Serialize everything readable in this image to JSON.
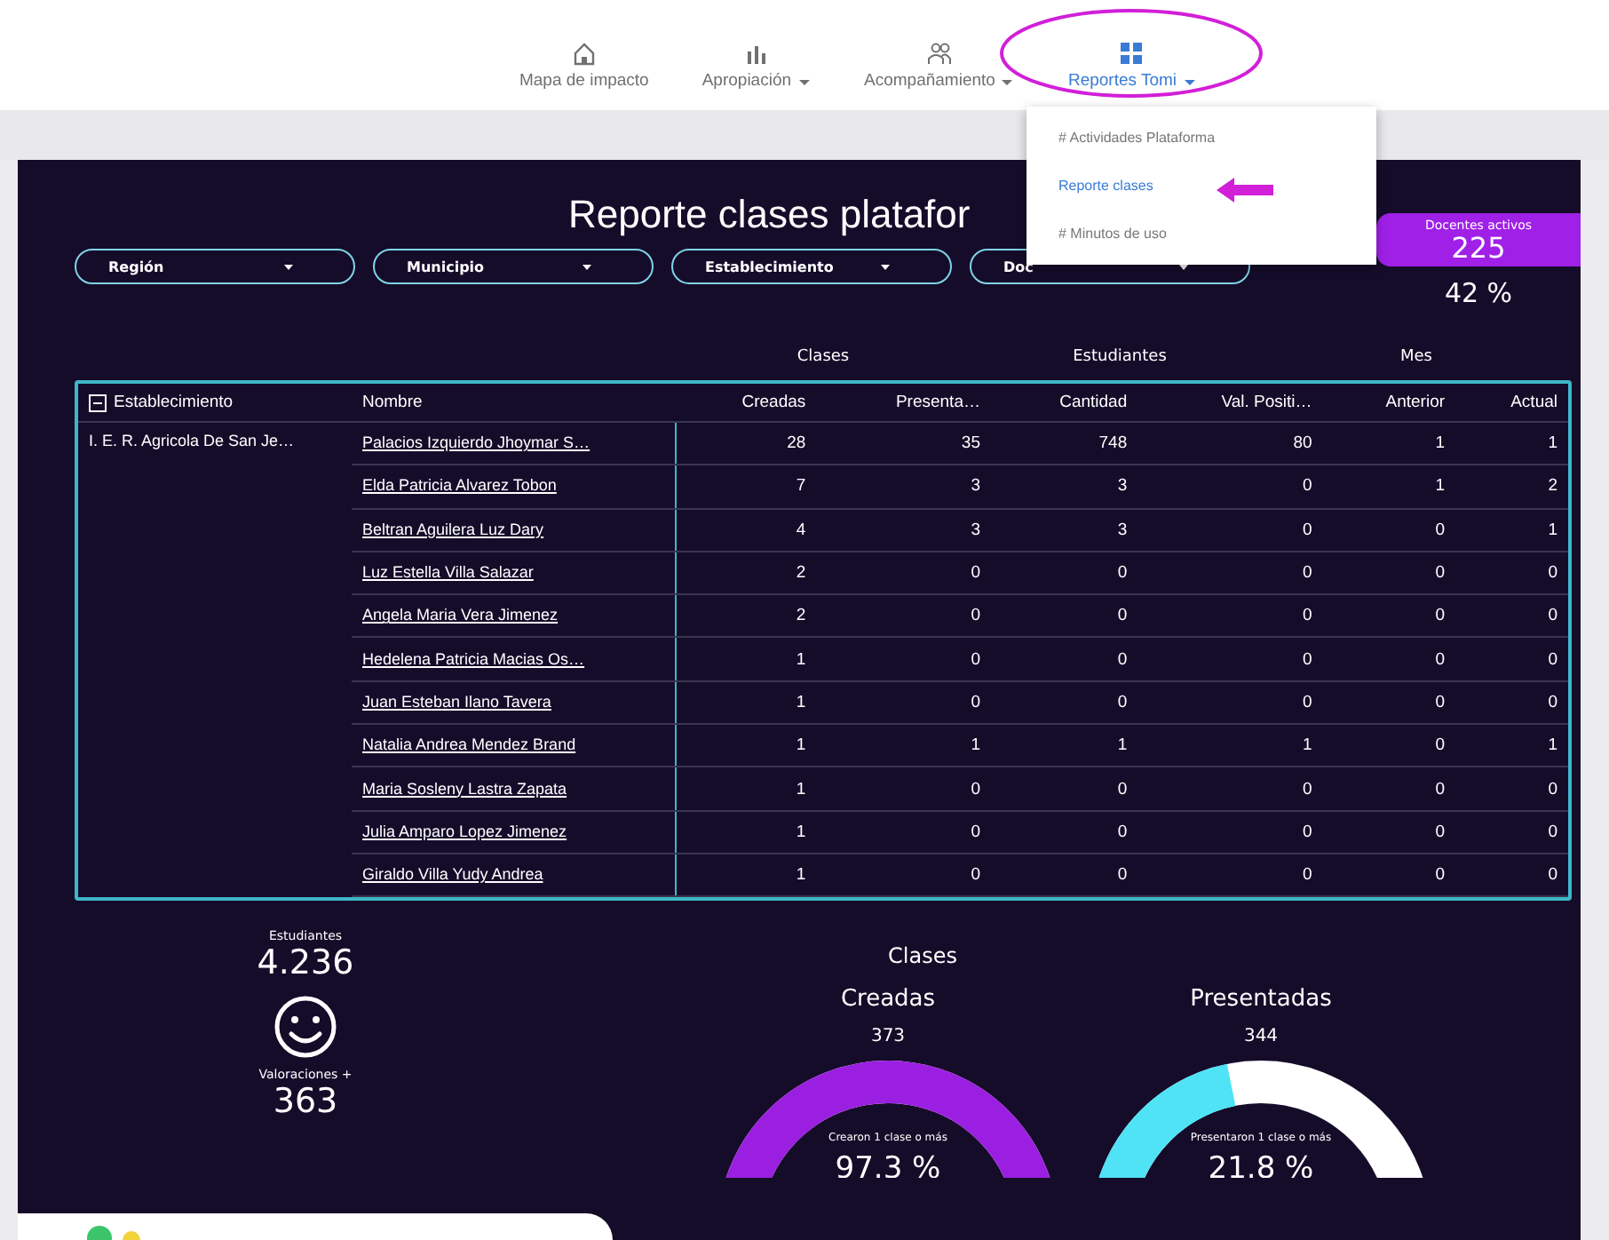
{
  "nav": {
    "items": [
      {
        "label": "Mapa de impacto",
        "has_menu": false,
        "selected": false
      },
      {
        "label": "Apropiación",
        "has_menu": true,
        "selected": false
      },
      {
        "label": "Acompañamiento",
        "has_menu": true,
        "selected": false
      },
      {
        "label": "Reportes Tomi",
        "has_menu": true,
        "selected": true
      }
    ]
  },
  "menu": {
    "items": [
      {
        "label": "# Actividades Plataforma",
        "selected": false
      },
      {
        "label": "Reporte clases",
        "selected": true
      },
      {
        "label": "# Minutos de uso",
        "selected": false
      }
    ]
  },
  "dashboard": {
    "title": "Reporte clases platafor",
    "kpi": {
      "label": "Docentes activos",
      "value": "225",
      "percent": "42 %"
    },
    "filters": [
      {
        "label": "Región"
      },
      {
        "label": "Municipio"
      },
      {
        "label": "Establecimiento"
      },
      {
        "label": "Doc"
      }
    ],
    "table": {
      "expanded": true,
      "columns": [
        "Establecimiento",
        "Nombre"
      ],
      "column_groups": [
        {
          "label": "Clases",
          "columns": [
            "Creadas",
            "Presenta…"
          ]
        },
        {
          "label": "Estudiantes",
          "columns": [
            "Cantidad",
            "Val. Positi…"
          ]
        },
        {
          "label": "Mes",
          "columns": [
            "Anterior",
            "Actual"
          ]
        }
      ],
      "groups": [
        {
          "establecimiento": "I. E. R. Agricola De San Je…",
          "rows": [
            {
              "nombre": "Palacios Izquierdo Jhoymar S…",
              "values": [
                "28",
                "35",
                "748",
                "80",
                "1",
                "1"
              ]
            },
            {
              "nombre": "Elda Patricia Alvarez Tobon",
              "values": [
                "7",
                "3",
                "3",
                "0",
                "1",
                "2"
              ]
            },
            {
              "nombre": "Beltran Aguilera Luz Dary",
              "values": [
                "4",
                "3",
                "3",
                "0",
                "0",
                "1"
              ]
            },
            {
              "nombre": "Luz Estella Villa Salazar",
              "values": [
                "2",
                "0",
                "0",
                "0",
                "0",
                "0"
              ]
            },
            {
              "nombre": "Angela Maria Vera Jimenez",
              "values": [
                "2",
                "0",
                "0",
                "0",
                "0",
                "0"
              ]
            },
            {
              "nombre": "Hedelena Patricia Macias Os…",
              "values": [
                "1",
                "0",
                "0",
                "0",
                "0",
                "0"
              ]
            },
            {
              "nombre": "Juan Esteban Ilano Tavera",
              "values": [
                "1",
                "0",
                "0",
                "0",
                "0",
                "0"
              ]
            },
            {
              "nombre": "Natalia Andrea Mendez Brand",
              "values": [
                "1",
                "1",
                "1",
                "1",
                "0",
                "1"
              ]
            },
            {
              "nombre": "Maria Sosleny Lastra Zapata",
              "values": [
                "1",
                "0",
                "0",
                "0",
                "0",
                "0"
              ]
            },
            {
              "nombre": "Julia Amparo Lopez Jimenez",
              "values": [
                "1",
                "0",
                "0",
                "0",
                "0",
                "0"
              ]
            },
            {
              "nombre": "Giraldo Villa Yudy Andrea",
              "values": [
                "1",
                "0",
                "0",
                "0",
                "0",
                "0"
              ]
            }
          ]
        }
      ]
    },
    "stats": [
      {
        "label": "Estudiantes",
        "value": "4.236"
      },
      {
        "label": "Valoraciones +",
        "value": "363"
      }
    ],
    "clases": {
      "title": "Clases",
      "donuts": [
        {
          "title": "Creadas",
          "total": "373",
          "caption": "Crearon 1 clase o más",
          "percent": "97.3 %",
          "color": "#9b1fe0"
        },
        {
          "title": "Presentadas",
          "total": "344",
          "caption": "Presentaron 1 clase o más",
          "percent": "21.8 %",
          "color": "#4fe3f5"
        }
      ]
    }
  }
}
